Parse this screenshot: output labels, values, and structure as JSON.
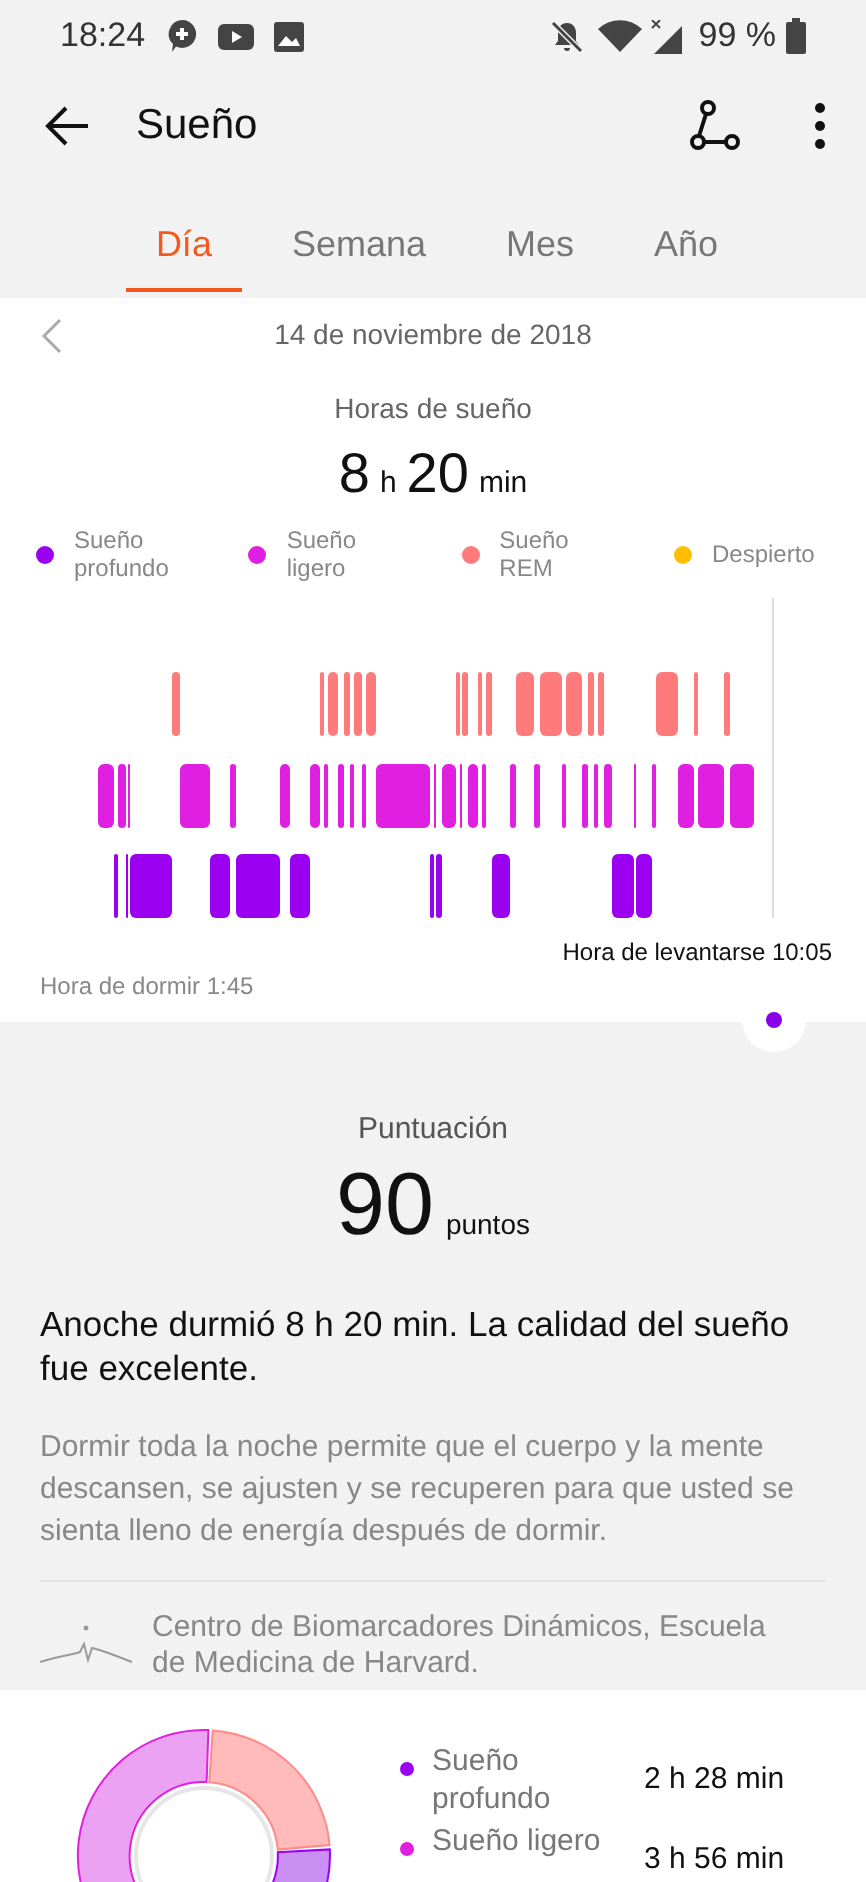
{
  "status_bar": {
    "time": "18:24",
    "battery": "99 %"
  },
  "app_bar": {
    "title": "Sueño"
  },
  "tabs": [
    {
      "label": "Día",
      "selected": true
    },
    {
      "label": "Semana",
      "selected": false
    },
    {
      "label": "Mes",
      "selected": false
    },
    {
      "label": "Año",
      "selected": false
    }
  ],
  "date": "14 de noviembre de 2018",
  "duration": {
    "label": "Horas de sueño",
    "hours": "8",
    "h_unit": "h",
    "minutes": "20",
    "min_unit": "min"
  },
  "legend": [
    {
      "label": "Sueño profundo",
      "color": "#9b00f0"
    },
    {
      "label": "Sueño ligero",
      "color": "#e020e0"
    },
    {
      "label": "Sueño REM",
      "color": "#ff7a7a"
    },
    {
      "label": "Despierto",
      "color": "#ffbf00"
    }
  ],
  "wake_time": "Hora de levantarse 10:05",
  "bed_time": "Hora de dormir 1:45",
  "score": {
    "label": "Puntuación",
    "value": "90",
    "unit": "puntos"
  },
  "summary": {
    "heading": "Anoche durmió 8 h 20 min. La calidad del sueño fue excelente.",
    "text": "Dormir toda la noche permite que el cuerpo y la mente descansen, se ajusten y se recuperen para que usted se sienta lleno de energía después de dormir.",
    "source": "Centro de Biomarcadores Dinámicos, Escuela de Medicina de Harvard."
  },
  "breakdown": [
    {
      "label": "Sueño profundo",
      "value": "2 h 28 min",
      "color": "#9b00f0"
    },
    {
      "label": "Sueño ligero",
      "value": "3 h 56 min",
      "color": "#e020e0"
    }
  ]
}
